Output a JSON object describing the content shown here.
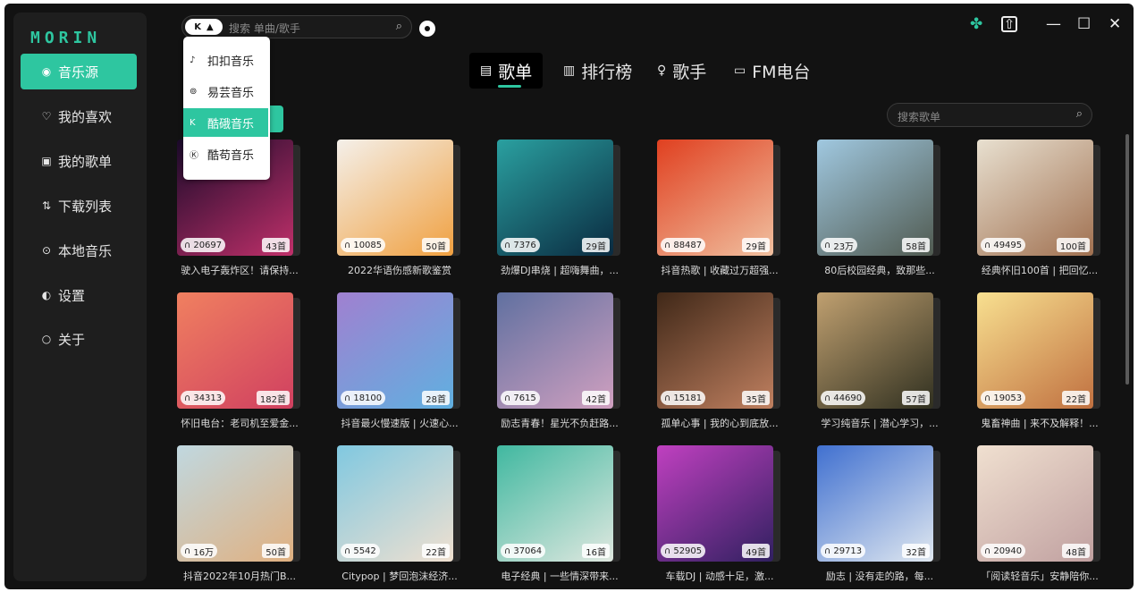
{
  "app": {
    "logo": "MORIN"
  },
  "sidebar": {
    "items": [
      {
        "icon": "music-source-icon",
        "glyph": "◉",
        "label": "音乐源",
        "active": true
      },
      {
        "icon": "heart-icon",
        "glyph": "♡",
        "label": "我的喜欢",
        "active": false
      },
      {
        "icon": "playlist-icon",
        "glyph": "▣",
        "label": "我的歌单",
        "active": false
      },
      {
        "icon": "download-icon",
        "glyph": "⇅",
        "label": "下载列表",
        "active": false
      },
      {
        "icon": "local-music-icon",
        "glyph": "⊙",
        "label": "本地音乐",
        "active": false
      },
      {
        "icon": "settings-icon",
        "glyph": "◐",
        "label": "设置",
        "active": false
      },
      {
        "icon": "about-icon",
        "glyph": "○",
        "label": "关于",
        "active": false
      }
    ]
  },
  "search": {
    "source_badge": "K",
    "placeholder": "搜索 单曲/歌手"
  },
  "source_dropdown": {
    "items": [
      {
        "glyph": "♪",
        "label": "扣扣音乐",
        "selected": false
      },
      {
        "glyph": "⊚",
        "label": "易芸音乐",
        "selected": false
      },
      {
        "glyph": "K",
        "label": "酷硪音乐",
        "selected": true
      },
      {
        "glyph": "Ⓚ",
        "label": "酷苟音乐",
        "selected": false
      }
    ]
  },
  "tabs": [
    {
      "icon": "songlist-icon",
      "glyph": "▤",
      "label": "歌单",
      "active": true
    },
    {
      "icon": "chart-icon",
      "glyph": "▥",
      "label": "排行榜",
      "active": false
    },
    {
      "icon": "singer-icon",
      "glyph": "♀",
      "label": "歌手",
      "active": false
    },
    {
      "icon": "radio-icon",
      "glyph": "▭",
      "label": "FM电台",
      "active": false
    }
  ],
  "playlist_search": {
    "placeholder": "搜索歌单"
  },
  "colors": {
    "accent": "#2ec6a0",
    "bg": "#121212",
    "sidebar": "#1e1e1e"
  },
  "playlists": [
    {
      "plays": "20697",
      "count": "43首",
      "title": "驶入电子轰炸区！请保持...",
      "colors": [
        "#1a0a2a",
        "#c0306a"
      ]
    },
    {
      "plays": "10085",
      "count": "50首",
      "title": "2022华语伤感新歌鉴赏",
      "colors": [
        "#f4f0ea",
        "#f0a040"
      ]
    },
    {
      "plays": "7376",
      "count": "29首",
      "title": "劲爆DJ串烧 | 超嗨舞曲，...",
      "colors": [
        "#2aa0a0",
        "#0a2a40"
      ]
    },
    {
      "plays": "88487",
      "count": "29首",
      "title": "抖音热歌 | 收藏过万超强...",
      "colors": [
        "#e04020",
        "#f0c0a0"
      ]
    },
    {
      "plays": "23万",
      "count": "58首",
      "title": "80后校园经典，致那些...",
      "colors": [
        "#a0c8e0",
        "#505a50"
      ]
    },
    {
      "plays": "49495",
      "count": "100首",
      "title": "经典怀旧100首 | 把回忆...",
      "colors": [
        "#e8e0d0",
        "#a07050"
      ]
    },
    {
      "plays": "34313",
      "count": "182首",
      "title": "怀旧电台：老司机至爱金...",
      "colors": [
        "#f08060",
        "#d04060"
      ]
    },
    {
      "plays": "18100",
      "count": "28首",
      "title": "抖音最火慢速版 | 火速心...",
      "colors": [
        "#a080d0",
        "#60b0e0"
      ]
    },
    {
      "plays": "7615",
      "count": "42首",
      "title": "励志青春！星光不负赶路...",
      "colors": [
        "#6070a0",
        "#d0a0c0"
      ]
    },
    {
      "plays": "15181",
      "count": "35首",
      "title": "孤单心事 | 我的心到底放...",
      "colors": [
        "#402818",
        "#c08060"
      ]
    },
    {
      "plays": "44690",
      "count": "57首",
      "title": "学习纯音乐 | 潜心学习，...",
      "colors": [
        "#c0a070",
        "#303020"
      ]
    },
    {
      "plays": "19053",
      "count": "22首",
      "title": "鬼畜神曲 | 来不及解释！...",
      "colors": [
        "#f8e090",
        "#c07040"
      ]
    },
    {
      "plays": "16万",
      "count": "50首",
      "title": "抖音2022年10月热门B...",
      "colors": [
        "#c0d8e0",
        "#e0b080"
      ]
    },
    {
      "plays": "5542",
      "count": "22首",
      "title": "Citypop | 梦回泡沫经济...",
      "colors": [
        "#80c8e0",
        "#f0e0d0"
      ]
    },
    {
      "plays": "37064",
      "count": "16首",
      "title": "电子经典 | 一些情深带来...",
      "colors": [
        "#40b8a0",
        "#e0e8e0"
      ]
    },
    {
      "plays": "52905",
      "count": "49首",
      "title": "车载DJ | 动感十足，激...",
      "colors": [
        "#c040c0",
        "#302060"
      ]
    },
    {
      "plays": "29713",
      "count": "32首",
      "title": "励志 | 没有走的路，每...",
      "colors": [
        "#4070d0",
        "#e0e8f0"
      ]
    },
    {
      "plays": "20940",
      "count": "48首",
      "title": "「阅读轻音乐」安静陪你...",
      "colors": [
        "#f0e0d0",
        "#c0a0a0"
      ]
    }
  ]
}
